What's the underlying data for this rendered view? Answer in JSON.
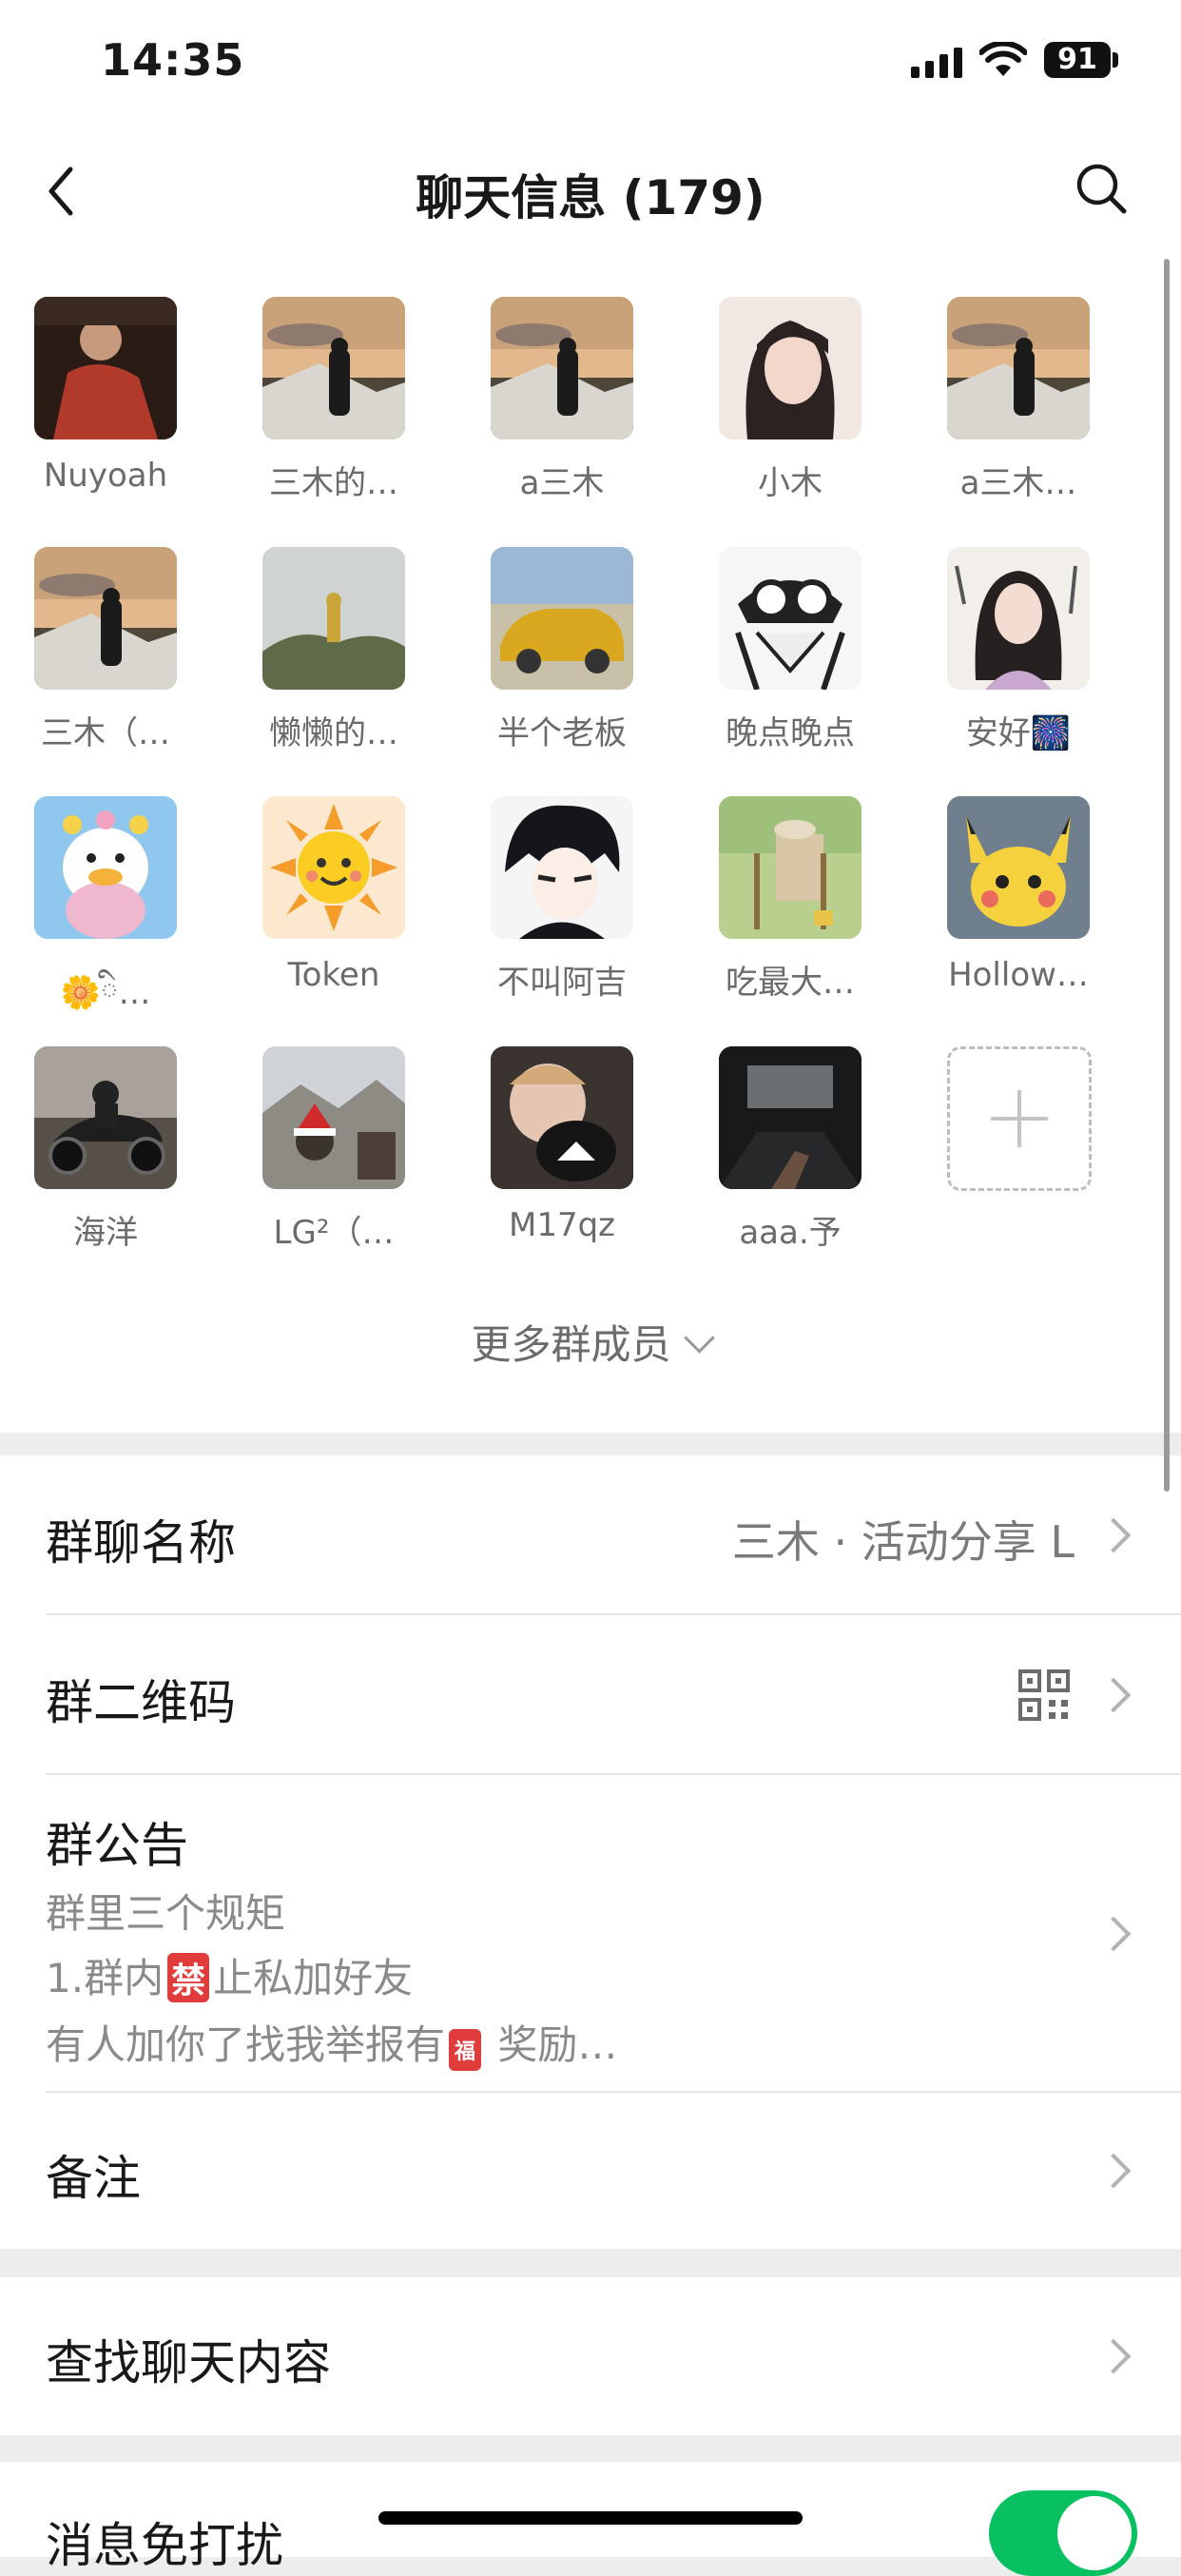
{
  "status_bar": {
    "time": "14:35",
    "battery": "91"
  },
  "nav": {
    "title": "聊天信息 (179)"
  },
  "members": [
    {
      "name": "Nuyoah",
      "avatar": "boy-red-jacket"
    },
    {
      "name": "三木的…",
      "avatar": "sunset-person"
    },
    {
      "name": "a三木",
      "avatar": "sunset-person"
    },
    {
      "name": "小木",
      "avatar": "girl-portrait"
    },
    {
      "name": "a三木…",
      "avatar": "sunset-person"
    },
    {
      "name": "三木（…",
      "avatar": "sunset-person"
    },
    {
      "name": "懒懒的…",
      "avatar": "foggy-hill"
    },
    {
      "name": "半个老板",
      "avatar": "gold-car"
    },
    {
      "name": "晚点晚点",
      "avatar": "anime-goggles"
    },
    {
      "name": "安好🎆",
      "avatar": "ink-girl"
    },
    {
      "name": "🌼ི…",
      "avatar": "cartoon-duck"
    },
    {
      "name": "Token",
      "avatar": "sun-emoji"
    },
    {
      "name": "不叫阿吉",
      "avatar": "anime-boy"
    },
    {
      "name": "吃最大…",
      "avatar": "field-chair"
    },
    {
      "name": "Hollow…",
      "avatar": "pichu"
    },
    {
      "name": "海洋",
      "avatar": "motorcycle"
    },
    {
      "name": "LG²（…",
      "avatar": "mountain-santa"
    },
    {
      "name": "M17qz",
      "avatar": "child-cat"
    },
    {
      "name": "aaa.予",
      "avatar": "dark-cinema"
    }
  ],
  "more_members": "更多群成员",
  "settings": {
    "group_name_label": "群聊名称",
    "group_name_value": "三木 · 活动分享 L",
    "qr_label": "群二维码",
    "notice_label": "群公告",
    "notice_line1": "群里三个规矩",
    "notice_line2a": "1.群内",
    "notice_line2_badge": "禁",
    "notice_line2b": "止私加好友",
    "notice_line3a": "有人加你了找我举报有",
    "notice_line3_badge": "福",
    "notice_line3b": " 奖励…",
    "remark_label": "备注",
    "search_label": "查找聊天内容",
    "mute_label": "消息免打扰"
  },
  "colors": {
    "accent": "#07c160",
    "background": "#ededed"
  }
}
